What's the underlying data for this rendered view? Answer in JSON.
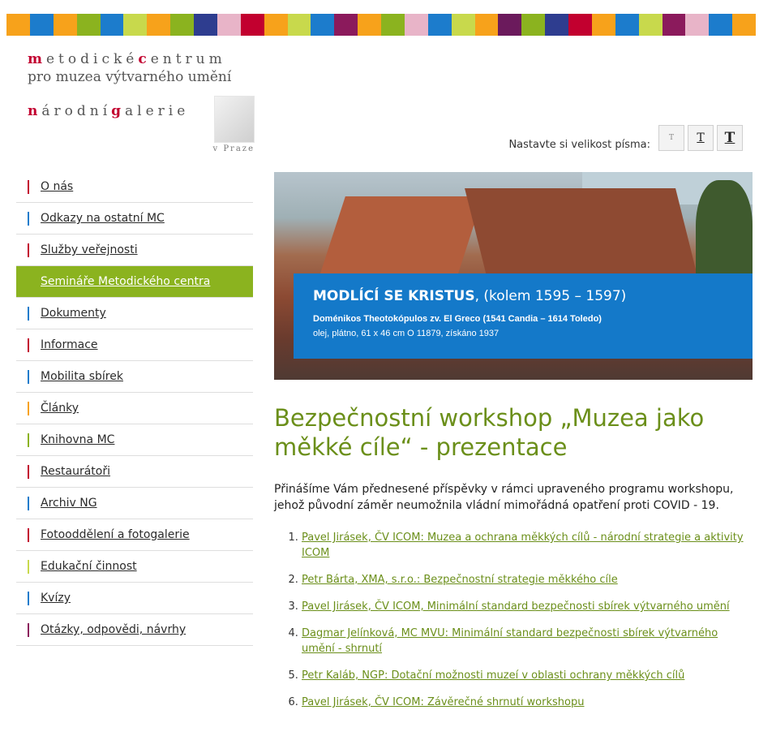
{
  "stripe_colors": [
    "#f7a21b",
    "#1c7ccc",
    "#f7a21b",
    "#8bb31f",
    "#1c7ccc",
    "#c8d94c",
    "#f7a21b",
    "#8bb31f",
    "#2e3d8f",
    "#e8b4c8",
    "#c2002f",
    "#f7a21b",
    "#c8d94c",
    "#1c7ccc",
    "#8b1a5c",
    "#f7a21b",
    "#8bb31f",
    "#e8b4c8",
    "#1c7ccc",
    "#c8d94c",
    "#f7a21b",
    "#6b1a5c",
    "#8bb31f",
    "#2e3d8f",
    "#c2002f",
    "#f7a21b",
    "#1c7ccc",
    "#c8d94c",
    "#8b1a5c",
    "#e8b4c8",
    "#1c7ccc",
    "#f7a21b"
  ],
  "logo": {
    "line1": [
      {
        "t": "m",
        "r": true
      },
      {
        "t": "etodické",
        "r": false
      },
      {
        "t": "c",
        "r": true
      },
      {
        "t": "entrum",
        "r": false
      }
    ],
    "line2": "pro muzea výtvarného umění",
    "line3": [
      {
        "t": "n",
        "r": true
      },
      {
        "t": "árodní",
        "r": false
      },
      {
        "t": "g",
        "r": true
      },
      {
        "t": "alerie",
        "r": false
      }
    ],
    "city": "v Praze"
  },
  "font_size": {
    "label": "Nastavte si velikost písma:",
    "small": "T",
    "medium": "T",
    "large": "T"
  },
  "nav": [
    {
      "label": "O nás",
      "color": "#c2002f",
      "active": false
    },
    {
      "label": "Odkazy na ostatní MC",
      "color": "#1c7ccc",
      "active": false
    },
    {
      "label": "Služby veřejnosti",
      "color": "#c2002f",
      "active": false
    },
    {
      "label": "Semináře Metodického centra",
      "color": "#8bb31f",
      "active": true
    },
    {
      "label": "Dokumenty",
      "color": "#1c7ccc",
      "active": false
    },
    {
      "label": "Informace",
      "color": "#c2002f",
      "active": false
    },
    {
      "label": "Mobilita sbírek",
      "color": "#1c7ccc",
      "active": false
    },
    {
      "label": "Články",
      "color": "#f7a21b",
      "active": false
    },
    {
      "label": "Knihovna MC",
      "color": "#8bb31f",
      "active": false
    },
    {
      "label": "Restaurátoři",
      "color": "#c2002f",
      "active": false
    },
    {
      "label": "Archiv NG",
      "color": "#1c7ccc",
      "active": false
    },
    {
      "label": "Fotooddělení a fotogalerie",
      "color": "#c2002f",
      "active": false
    },
    {
      "label": "Edukační činnost",
      "color": "#c8d94c",
      "active": false
    },
    {
      "label": "Kvízy",
      "color": "#1c7ccc",
      "active": false
    },
    {
      "label": "Otázky, odpovědi, návrhy",
      "color": "#8b1a5c",
      "active": false
    }
  ],
  "hero": {
    "title_bold": "MODLÍCÍ SE KRISTUS",
    "title_rest": ", (kolem 1595 – 1597)",
    "author": "Doménikos Theotokópulos zv. El Greco (1541 Candia – 1614 Toledo)",
    "details": "olej, plátno, 61 x 46 cm O 11879, získáno 1937"
  },
  "main": {
    "title": "Bezpečnostní workshop „Muzea jako měkké cíle“ - prezentace",
    "intro": "Přinášíme Vám přednesené příspěvky v rámci upraveného programu workshopu, jehož původní záměr neumožnila vládní mimořádná opatření proti COVID - 19.",
    "items": [
      "Pavel Jirásek, ČV ICOM: Muzea a ochrana měkkých cílů - národní strategie a aktivity ICOM",
      "Petr Bárta, XMA, s.r.o.:  Bezpečnostní strategie měkkého cíle",
      "Pavel Jirásek, ČV ICOM, Minimální standard bezpečnosti sbírek výtvarného umění",
      "Dagmar Jelínková, MC MVU: Minimální standard bezpečnosti sbírek výtvarného umění - shrnutí",
      "Petr Kaláb, NGP: Dotační možnosti muzeí v oblasti ochrany měkkých cílů",
      "Pavel Jirásek, ČV ICOM: Závěrečné shrnutí workshopu"
    ]
  }
}
